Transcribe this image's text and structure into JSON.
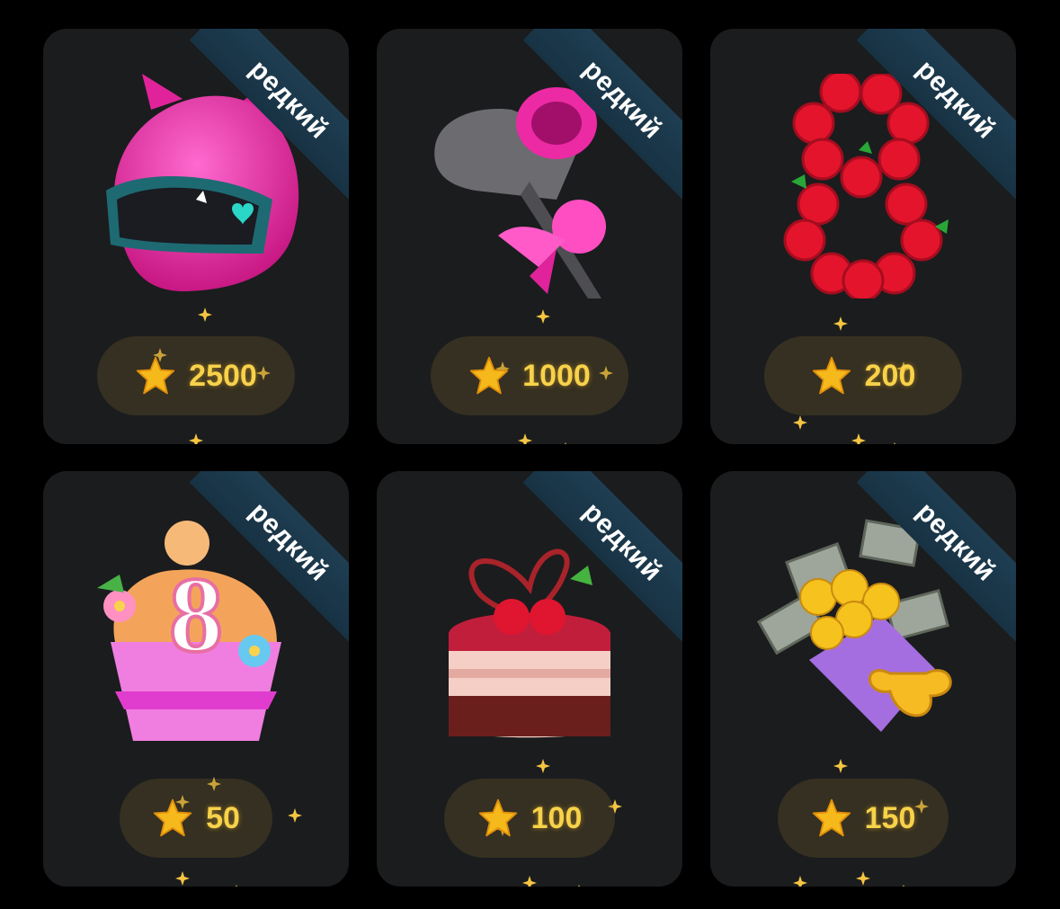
{
  "gifts": [
    {
      "badge": "редкий",
      "price": "2500",
      "icon": "cat-ear-helmet-icon"
    },
    {
      "badge": "редкий",
      "price": "1000",
      "icon": "hair-dryer-gift-icon"
    },
    {
      "badge": "редкий",
      "price": "200",
      "icon": "rose-number-eight-icon"
    },
    {
      "badge": "",
      "price": "50",
      "icon": "cupcake-eight-icon"
    },
    {
      "badge": "редкий",
      "price": "100",
      "icon": "cherry-cake-icon"
    },
    {
      "badge": "редкий",
      "price": "150",
      "icon": "money-bouquet-icon"
    }
  ],
  "colors": {
    "card_bg": "#1b1c1e",
    "ribbon": "#1f3e52",
    "price_text": "#f7d24a",
    "star": "#f5b91c"
  }
}
